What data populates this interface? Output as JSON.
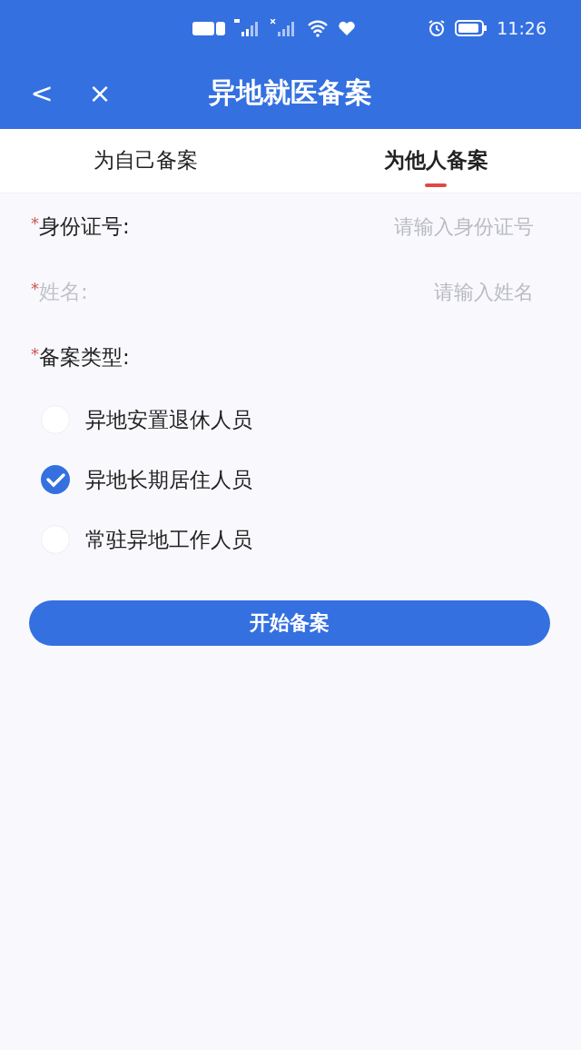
{
  "status_bar": {
    "time": "11:26"
  },
  "header": {
    "back": "<",
    "close": "×",
    "title": "异地就医备案"
  },
  "tabs": [
    {
      "label": "为自己备案",
      "selected": false
    },
    {
      "label": "为他人备案",
      "selected": true
    }
  ],
  "fields": [
    {
      "marker": "*",
      "label": "身份证号:",
      "placeholder": "请输入身份证号",
      "disabled": false
    },
    {
      "marker": "*",
      "label": "姓名:",
      "placeholder": "请输入姓名",
      "disabled": true
    }
  ],
  "type_field": {
    "marker": "*",
    "label": "备案类型:"
  },
  "options": [
    {
      "label": "异地安置退休人员",
      "selected": false
    },
    {
      "label": "异地长期居住人员",
      "selected": true
    },
    {
      "label": "常驻异地工作人员",
      "selected": false
    }
  ],
  "submit": "开始备案"
}
